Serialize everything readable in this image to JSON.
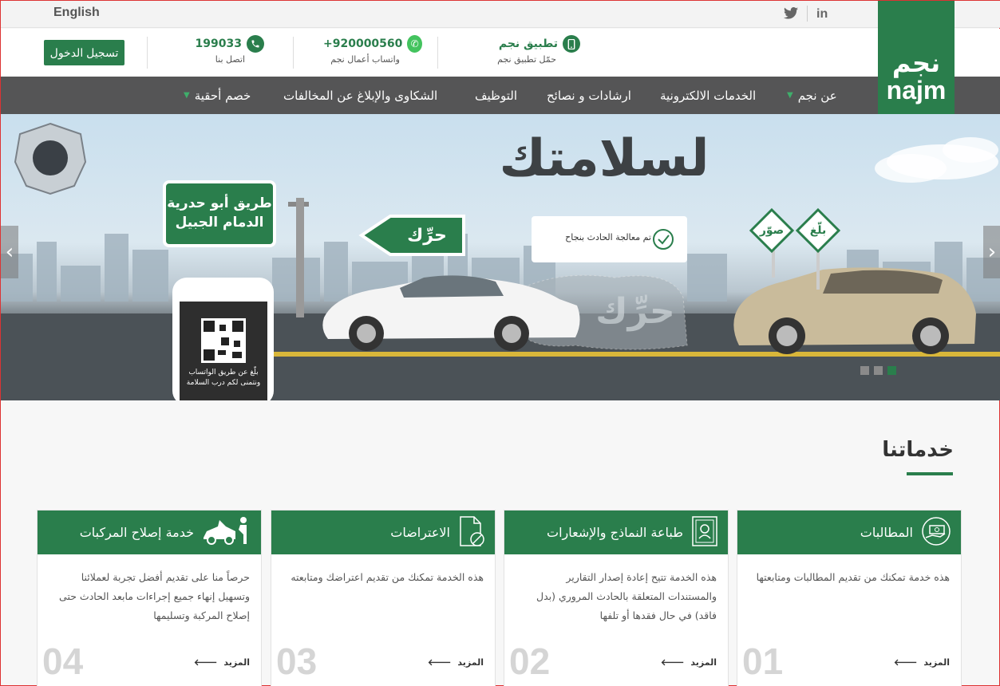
{
  "topbar": {
    "language": "English",
    "social": [
      "in",
      "twitter"
    ]
  },
  "header": {
    "login_label": "تسجيل الدخول",
    "call": {
      "number": "199033",
      "label": "اتصل بنا"
    },
    "whatsapp": {
      "number": "+920000560",
      "label": "واتساب أعمال نجم"
    },
    "app": {
      "title": "تطبيق نجم",
      "label": "حمّل تطبيق نجم"
    }
  },
  "logo": {
    "arabic": "نجم",
    "latin": "najm"
  },
  "nav": [
    {
      "label": "عن نجم",
      "has_menu": true
    },
    {
      "label": "الخدمات الالكترونية",
      "has_menu": false
    },
    {
      "label": "ارشادات و نصائح",
      "has_menu": false
    },
    {
      "label": "التوظيف",
      "has_menu": false
    },
    {
      "label": "الشكاوى والإبلاغ عن المخالفات",
      "has_menu": false
    },
    {
      "label": "خصم أحقية",
      "has_menu": true
    }
  ],
  "hero": {
    "headline": "لسلامتك",
    "road_sign_line1": "طريق أبو حدرية",
    "road_sign_line2": "الدمام الجبيل",
    "move_sign": "حرِّك",
    "status_bubble": "تم معالجة الحادث بنجاح",
    "sign_report": "بلّغ",
    "sign_photo": "صوّر",
    "phone_line1": "بلّغ عن طريق الواتساب",
    "phone_line2": "ونتمنى لكم درب السلامة",
    "watermark": "حرِّك",
    "slides": 3,
    "active_slide": 3
  },
  "services": {
    "title": "خدماتنا",
    "more_label": "المزيد",
    "cards": [
      {
        "num": "01",
        "title": "المطالبات",
        "body": "هذه خدمة تمكنك من تقديم المطالبات ومتابعتها",
        "icon": "claims-icon"
      },
      {
        "num": "02",
        "title": "طباعة النماذج والإشعارات",
        "body": "هذه الخدمة تتيح إعادة إصدار التقارير والمستندات المتعلقة بالحادث المروري (بدل فاقد) في حال فقدها أو تلفها",
        "icon": "document-badge-icon"
      },
      {
        "num": "03",
        "title": "الاعتراضات",
        "body": "هذه الخدمة تمكنك من تقديم اعتراضك ومتابعته",
        "icon": "objection-file-icon"
      },
      {
        "num": "04",
        "title": "خدمة إصلاح المركبات",
        "body": "حرصاً منا على تقديم أفضل تجربة لعملائنا وتسهيل إنهاء جميع إجراءات مابعد الحادث حتى إصلاح المركبة وتسليمها",
        "icon": "car-repair-icon"
      }
    ]
  },
  "colors": {
    "brand": "#2a7e4c",
    "nav": "#555556",
    "whatsapp": "#43c35e"
  }
}
